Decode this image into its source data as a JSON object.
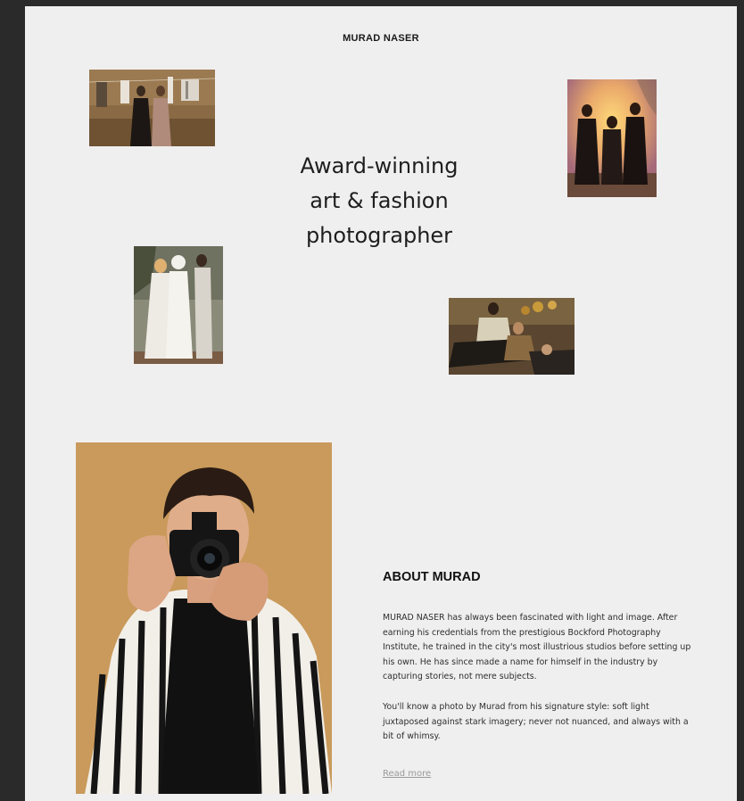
{
  "header": {
    "brand": "MURAD NASER"
  },
  "hero": {
    "lines": [
      "Award-winning",
      "art & fashion",
      "photographer"
    ]
  },
  "gallery": [
    {
      "id": "laundry-scene"
    },
    {
      "id": "sunset-trio"
    },
    {
      "id": "white-gowns-group"
    },
    {
      "id": "lounging-group"
    }
  ],
  "about": {
    "title": "ABOUT MURAD",
    "paragraphs": [
      "MURAD NASER has always been fascinated with light and image. After earning his credentials from the prestigious Bockford Photography Institute, he trained in the city's most illustrious studios before setting up his own. He has since made a name for himself in the industry by capturing stories, not mere subjects.",
      "You'll know a photo by Murad from his signature style: soft light juxtaposed against stark imagery; never not nuanced, and always with a bit of whimsy."
    ],
    "read_more": "Read more"
  },
  "colors": {
    "page_bg": "#f0efef",
    "frame_bg": "#2a2a2a",
    "portrait_bg": "#c99a5b",
    "text": "#1e1e1e",
    "muted_link": "#9a9a9a"
  }
}
